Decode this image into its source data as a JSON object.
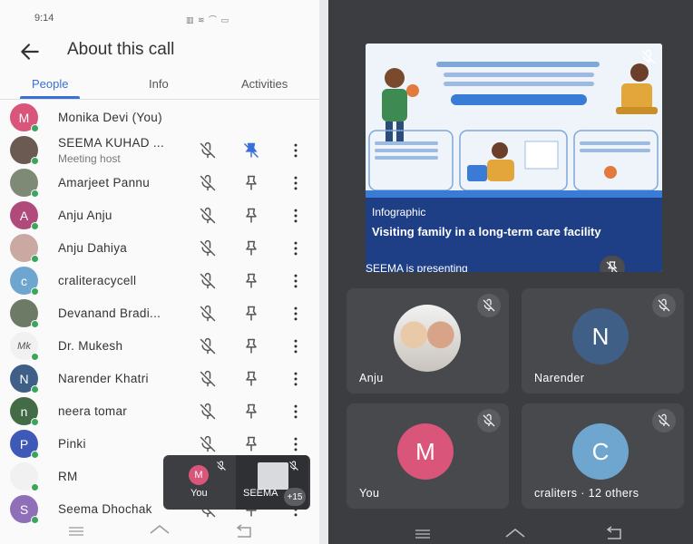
{
  "status": {
    "time": "9:14",
    "right": "▥ ≋ ⌒ ▭"
  },
  "header": {
    "title": "About this call"
  },
  "tabs": [
    {
      "label": "People",
      "active": true
    },
    {
      "label": "Info",
      "active": false
    },
    {
      "label": "Activities",
      "active": false
    }
  ],
  "participants": [
    {
      "name": "Monika Devi (You)",
      "avatar_letter": "M",
      "avatar_color": "#d9557a",
      "controls": false
    },
    {
      "name": "SEEMA KUHAD ...",
      "subtitle": "Meeting host",
      "avatar_letter": "",
      "avatar_color": "#6a5a52",
      "controls": true,
      "pinned": true
    },
    {
      "name": "Amarjeet Pannu",
      "avatar_letter": "",
      "avatar_color": "#7f8a76",
      "controls": true
    },
    {
      "name": "Anju Anju",
      "avatar_letter": "A",
      "avatar_color": "#b04a7a",
      "controls": true
    },
    {
      "name": "Anju Dahiya",
      "avatar_letter": "",
      "avatar_color": "#c9a9a2",
      "controls": true
    },
    {
      "name": "craliteracycell",
      "avatar_letter": "c",
      "avatar_color": "#6fa6cf",
      "controls": true
    },
    {
      "name": "Devanand Bradi...",
      "avatar_letter": "",
      "avatar_color": "#6d7b66",
      "controls": true
    },
    {
      "name": "Dr. Mukesh",
      "avatar_letter": "Mk",
      "avatar_color": "#f1f1f1",
      "controls": true
    },
    {
      "name": "Narender Khatri",
      "avatar_letter": "N",
      "avatar_color": "#3f5f86",
      "controls": true
    },
    {
      "name": "neera tomar",
      "avatar_letter": "n",
      "avatar_color": "#436b45",
      "controls": true
    },
    {
      "name": "Pinki",
      "avatar_letter": "P",
      "avatar_color": "#3f59b8",
      "controls": true
    },
    {
      "name": "RM",
      "avatar_letter": "",
      "avatar_color": "#f1f1f1",
      "controls": true
    },
    {
      "name": "Seema Dhochak",
      "avatar_letter": "S",
      "avatar_color": "#8f6fb8",
      "controls": true
    }
  ],
  "mini_preview": {
    "you_letter": "M",
    "you_label": "You",
    "presenter_label": "SEEMA",
    "overflow": "+15"
  },
  "presentation": {
    "tag": "Infographic",
    "title": "Visiting family in a long-term care facility",
    "presenting": "SEEMA is presenting"
  },
  "tiles": [
    {
      "name": "Anju",
      "letter": "",
      "color": "#d3c9c1"
    },
    {
      "name": "Narender",
      "letter": "N",
      "color": "#3f5f86"
    },
    {
      "name": "You",
      "letter": "M",
      "color": "#d9557a"
    },
    {
      "name": "craliters · 12 others",
      "letter": "C",
      "color": "#6fa6cf"
    }
  ],
  "colors": {
    "accent": "#3a6fd8",
    "online": "#3ba55d",
    "dark_bg": "#3c3d40",
    "tile_bg": "#47494c",
    "caption_bg": "#1e3f86"
  }
}
